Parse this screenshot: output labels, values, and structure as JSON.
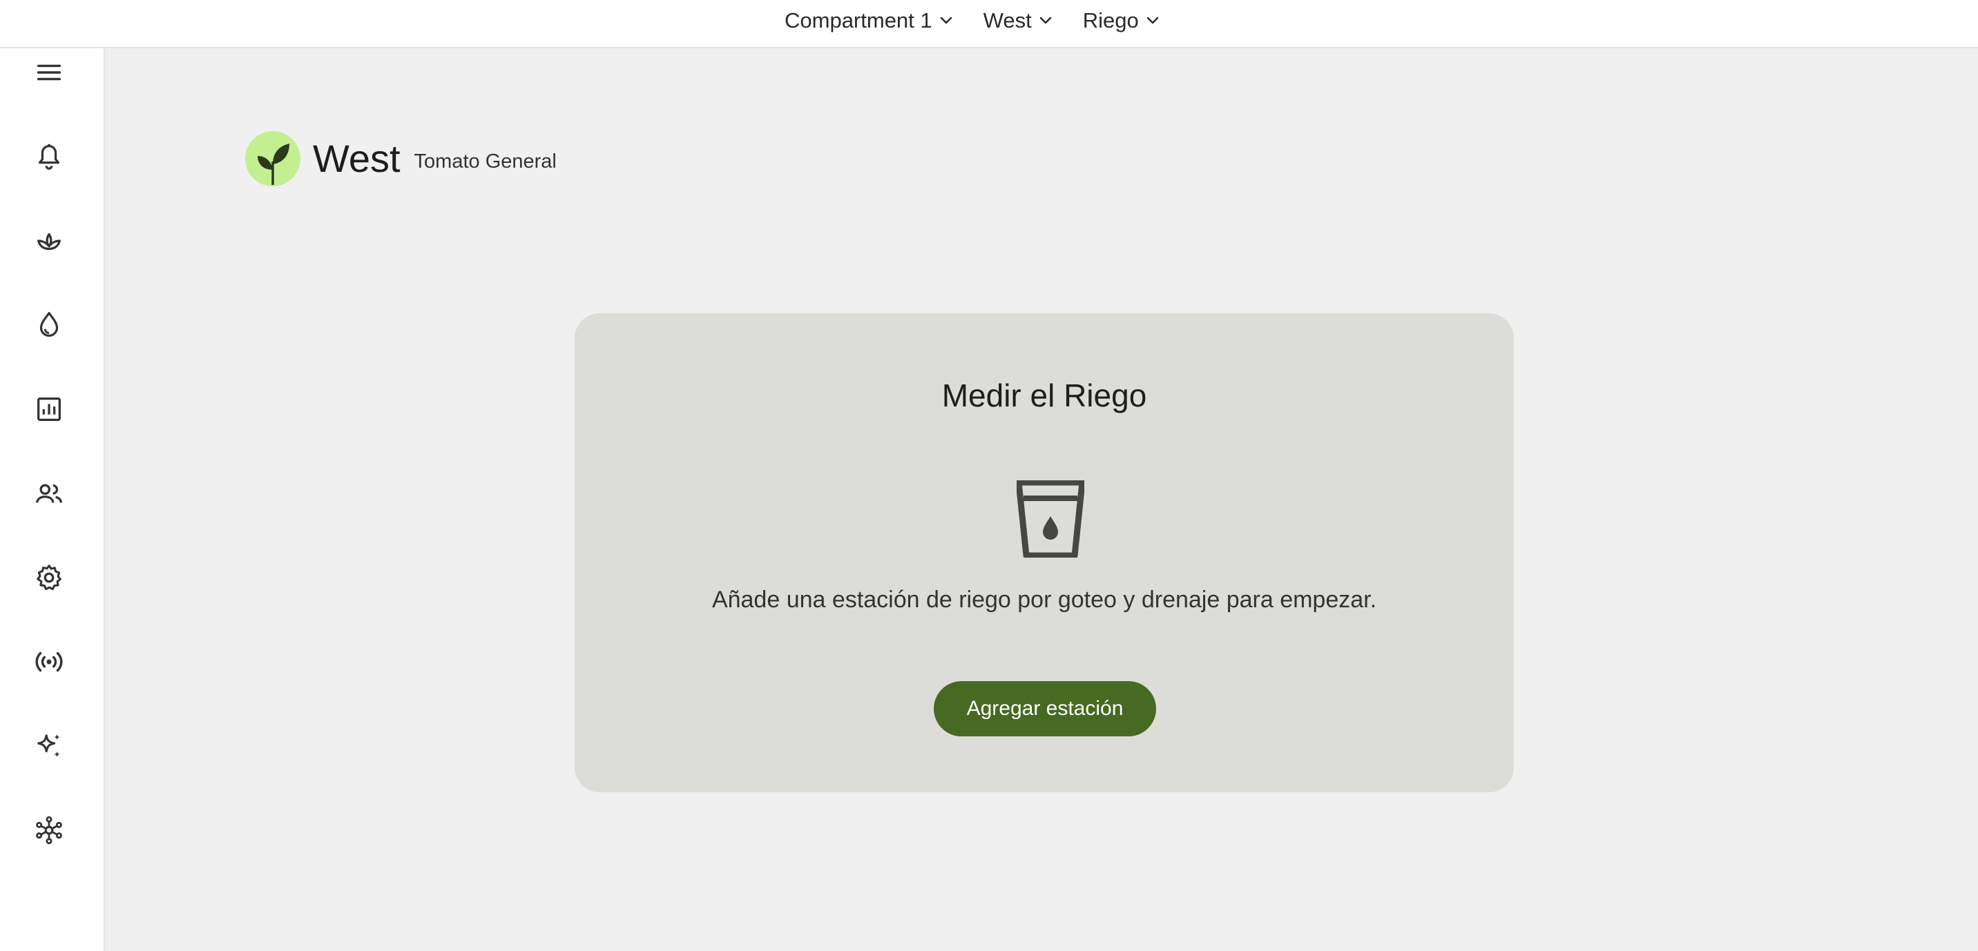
{
  "topbar": {
    "crumbs": [
      {
        "label": "Compartment 1",
        "icon": "chevron-down-icon"
      },
      {
        "label": "West",
        "icon": "chevron-down-icon"
      },
      {
        "label": "Riego",
        "icon": "chevron-down-icon"
      }
    ]
  },
  "sidebar": {
    "items": [
      {
        "icon": "menu-icon"
      },
      {
        "icon": "bell-icon"
      },
      {
        "icon": "plant-icon"
      },
      {
        "icon": "water-drop-icon"
      },
      {
        "icon": "bar-chart-icon"
      },
      {
        "icon": "people-icon"
      },
      {
        "icon": "gear-icon"
      },
      {
        "icon": "broadcast-icon"
      },
      {
        "icon": "sparkle-icon"
      },
      {
        "icon": "network-icon"
      }
    ]
  },
  "header": {
    "title": "West",
    "subtitle": "Tomato General",
    "logo_icon": "sprout-icon",
    "logo_color": "#c3ef91"
  },
  "card": {
    "title": "Medir el Riego",
    "icon": "water-glass-icon",
    "description": "Añade una estación de riego por goteo y drenaje para empezar.",
    "button_label": "Agregar estación",
    "button_color": "#466a22"
  }
}
